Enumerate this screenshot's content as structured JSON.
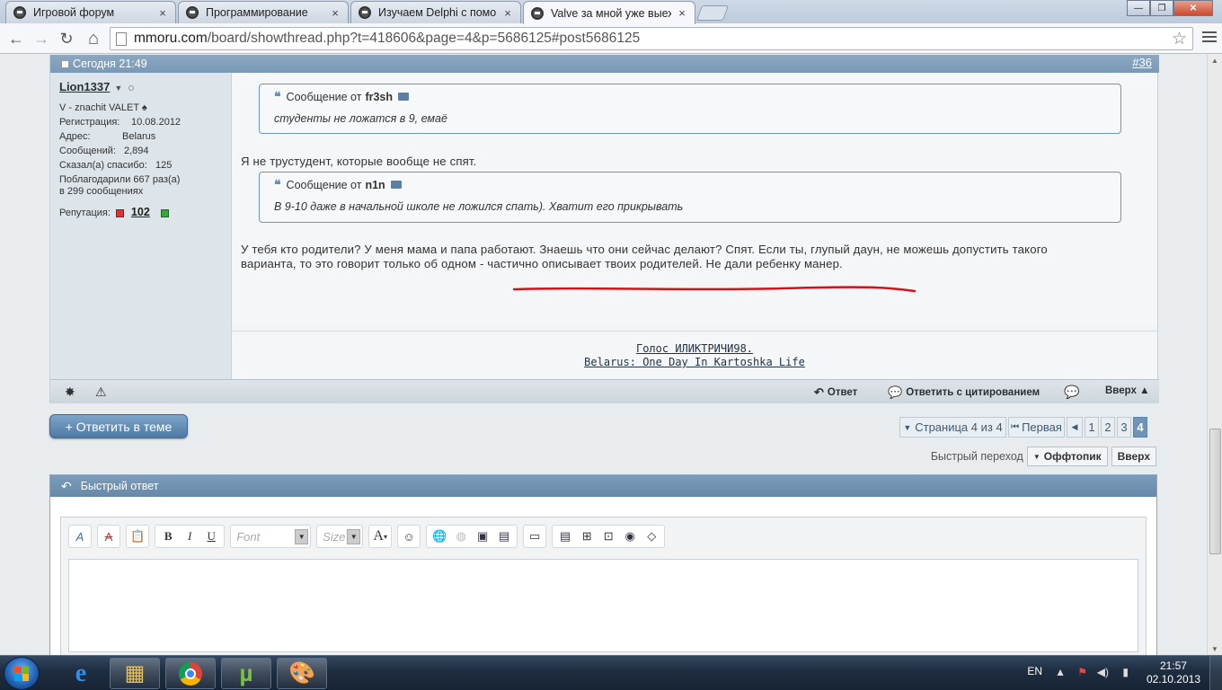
{
  "browser": {
    "tabs": [
      {
        "title": "Игровой форум",
        "active": false
      },
      {
        "title": "Программирование",
        "active": false
      },
      {
        "title": "Изучаем Delphi с помощ",
        "active": false
      },
      {
        "title": "Valve за мной уже выехал",
        "active": true
      }
    ],
    "close_glyph": "×",
    "url_host": "mmoru.com",
    "url_path": "/board/showthread.php?t=418606&page=4&p=5686125#post5686125",
    "nav": {
      "back": "←",
      "forward": "→",
      "reload": "↻",
      "home": "⌂",
      "star": "☆"
    },
    "window": {
      "minimize": "—",
      "maximize": "❐",
      "close": "✕"
    }
  },
  "post": {
    "date": "Сегодня 21:49",
    "number": "#36",
    "user": {
      "name": "Lion1337",
      "status_arrow": "▼",
      "title": "V - znachit VALET ♠",
      "fields": [
        {
          "label": "Регистрация:",
          "value": "10.08.2012"
        },
        {
          "label": "Адрес:",
          "value": "Belarus"
        },
        {
          "label": "Сообщений:",
          "value": "2,894"
        },
        {
          "label": "Сказал(а) спасибо:",
          "value": "125"
        }
      ],
      "thanked_line1": "Поблагодарили 667 раз(а)",
      "thanked_line2": "в 299 сообщениях",
      "rep_label": "Репутация:",
      "rep_value": "102"
    },
    "quote1": {
      "prefix": "Сообщение от",
      "author": "fr3sh",
      "text": "студенты не ложатся в 9, емаё"
    },
    "text1": "Я не трустудент, которые вообще не спят.",
    "quote2": {
      "prefix": "Сообщение от",
      "author": "n1n",
      "text": "В 9-10 даже в начальной школе не ложился спать). Хватит его прикрывать"
    },
    "text2_line1": "У тебя кто родители? У меня мама и папа работают. Знаешь что они сейчас делают? Спят. Если ты, глупый даун, не можешь допустить такого",
    "text2_line2": "варианта, то это говорит только об одном - частично описывает твоих родителей. Не дали ребенку манер.",
    "signature": [
      "Голос ИЛИКТРИЧИ98.",
      "Belarus: One Day In Kartoshka Life"
    ],
    "footer": {
      "reply": "Ответ",
      "reply_quote": "Ответить с цитированием",
      "top": "Вверх ▲"
    }
  },
  "thread": {
    "reply_button": "+ Ответить в теме",
    "pagination": {
      "label": "Страница 4 из 4",
      "first": "Первая",
      "prev": "◀",
      "pages": [
        "1",
        "2",
        "3",
        "4"
      ],
      "current": "4"
    },
    "quick_jump_label": "Быстрый переход",
    "quick_jump_select": "Оффтопик",
    "quick_jump_go": "Вверх"
  },
  "quick_reply": {
    "title": "Быстрый ответ",
    "font_placeholder": "Font",
    "size_placeholder": "Size"
  },
  "taskbar": {
    "lang": "EN",
    "time": "21:57",
    "date": "02.10.2013"
  },
  "colors": {
    "post_header": "#7a99b6",
    "underline_annotation": "#d0141a",
    "reply_button": "#4e7aa4"
  }
}
